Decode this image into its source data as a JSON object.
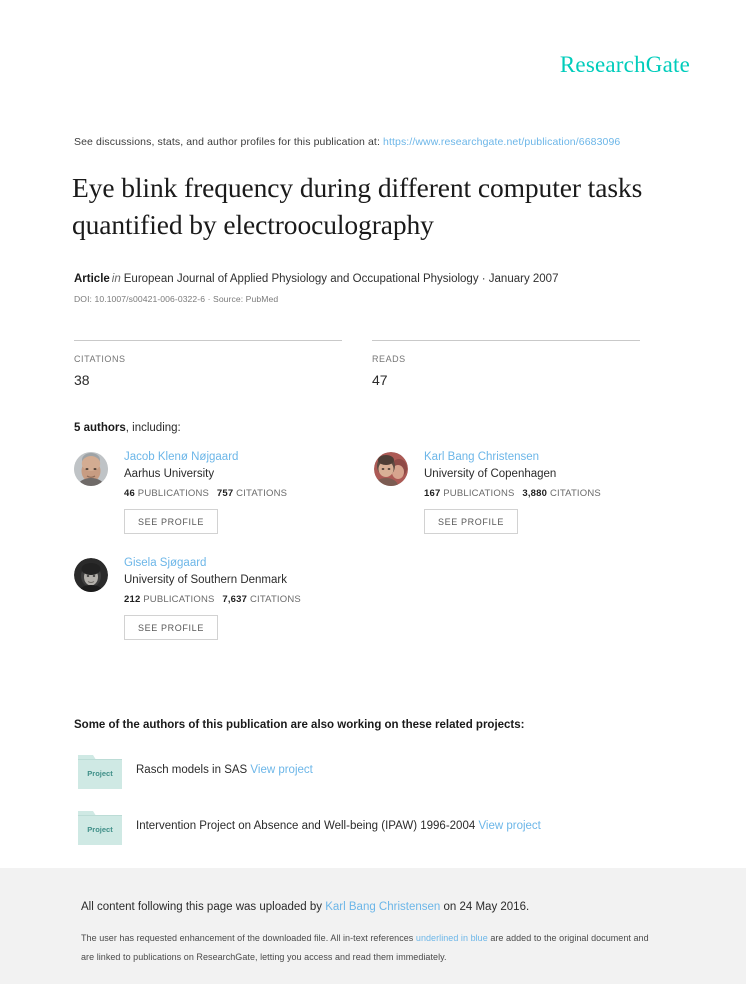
{
  "brand": {
    "name": "ResearchGate",
    "color": "#00ccbb"
  },
  "discussion": {
    "prefix": "See discussions, stats, and author profiles for this publication at:",
    "url": "https://www.researchgate.net/publication/6683096"
  },
  "title": "Eye blink frequency during different computer tasks quantified by electrooculography",
  "article": {
    "kind": "Article",
    "in": "in",
    "journal": "European Journal of Applied Physiology and Occupational Physiology · January 2007",
    "doi_line": "DOI: 10.1007/s00421-006-0322-6 · Source: PubMed"
  },
  "stats": [
    {
      "label": "CITATIONS",
      "value": "38"
    },
    {
      "label": "READS",
      "value": "47"
    }
  ],
  "authors_heading": {
    "count": "5 authors",
    "rest": ", including:"
  },
  "authors": [
    {
      "name": "Jacob Klenø Nøjgaard",
      "affiliation": "Aarhus University",
      "publications": "46",
      "publications_label": "PUBLICATIONS",
      "citations": "757",
      "citations_label": "CITATIONS",
      "button": "SEE PROFILE",
      "avatar": "avatar-bald-man"
    },
    {
      "name": "Karl Bang Christensen",
      "affiliation": "University of Copenhagen",
      "publications": "167",
      "publications_label": "PUBLICATIONS",
      "citations": "3,880",
      "citations_label": "CITATIONS",
      "button": "SEE PROFILE",
      "avatar": "avatar-two-people"
    },
    {
      "name": "Gisela Sjøgaard",
      "affiliation": "University of Southern Denmark",
      "publications": "212",
      "publications_label": "PUBLICATIONS",
      "citations": "7,637",
      "citations_label": "CITATIONS",
      "button": "SEE PROFILE",
      "avatar": "avatar-dark-portrait"
    }
  ],
  "projects_heading": "Some of the authors of this publication are also working on these related projects:",
  "projects": [
    {
      "icon_label": "Project",
      "title": "Rasch models in SAS",
      "link": "View project"
    },
    {
      "icon_label": "Project",
      "title": "Intervention Project on Absence and Well-being (IPAW) 1996-2004",
      "link": "View project"
    }
  ],
  "footer": {
    "upload_prefix": "All content following this page was uploaded by",
    "uploader": "Karl Bang Christensen",
    "upload_suffix": "on 24 May 2016.",
    "note_part1": "The user has requested enhancement of the downloaded file. All in-text references",
    "note_link": "underlined in blue",
    "note_part2": "are added to the original document and are linked to publications on ResearchGate, letting you access and read them immediately."
  }
}
